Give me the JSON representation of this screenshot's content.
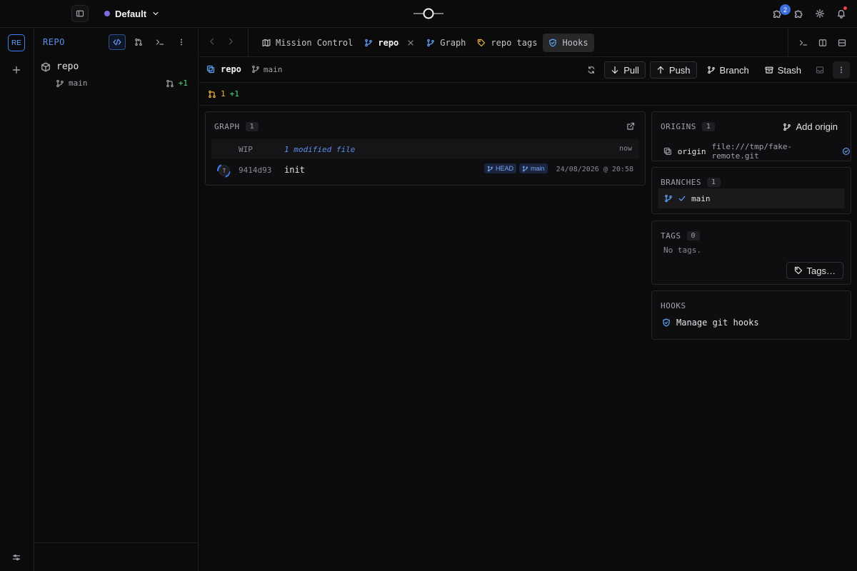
{
  "workspace": {
    "name": "Default",
    "color": "#7c6ce0"
  },
  "notifications": {
    "extensions_badge": "2"
  },
  "rail": {
    "project_initials": "RE"
  },
  "left_panel": {
    "title": "REPO",
    "repo_name": "repo",
    "branch": "main",
    "branch_changes": "+1"
  },
  "tabs": [
    {
      "label": "Mission Control",
      "icon": "map-icon"
    },
    {
      "label": "repo",
      "icon": "branch-icon",
      "active": true
    },
    {
      "label": "Graph",
      "icon": "branch-icon"
    },
    {
      "label": "repo tags",
      "icon": "tag-icon"
    },
    {
      "label": "Hooks",
      "icon": "shield-check-icon"
    }
  ],
  "repo_bar": {
    "repo": "repo",
    "branch": "main",
    "pull": "Pull",
    "push": "Push",
    "branch_btn": "Branch",
    "stash": "Stash"
  },
  "status": {
    "changes": "1",
    "added": "+1"
  },
  "graph": {
    "title": "GRAPH",
    "count": "1",
    "wip": {
      "label": "WIP",
      "message": "1 modified file",
      "time": "now"
    },
    "commits": [
      {
        "avatar": "T",
        "hash": "9414d93",
        "message": "init",
        "refs": [
          "HEAD",
          "main"
        ],
        "date": "24/08/2026 @ 20:58"
      }
    ]
  },
  "origins": {
    "title": "ORIGINS",
    "count": "1",
    "add_label": "Add origin",
    "items": [
      {
        "name": "origin",
        "url": "file:///tmp/fake-remote.git"
      }
    ]
  },
  "branches": {
    "title": "BRANCHES",
    "count": "1",
    "items": [
      {
        "name": "main",
        "current": true
      }
    ]
  },
  "tags": {
    "title": "TAGS",
    "count": "0",
    "empty": "No tags.",
    "button": "Tags…"
  },
  "hooks": {
    "title": "HOOKS",
    "link": "Manage git hooks"
  },
  "colors": {
    "accent": "#3b82f6",
    "add": "#4ade80",
    "warn": "#f5b342",
    "bg": "#0b0b0c"
  }
}
